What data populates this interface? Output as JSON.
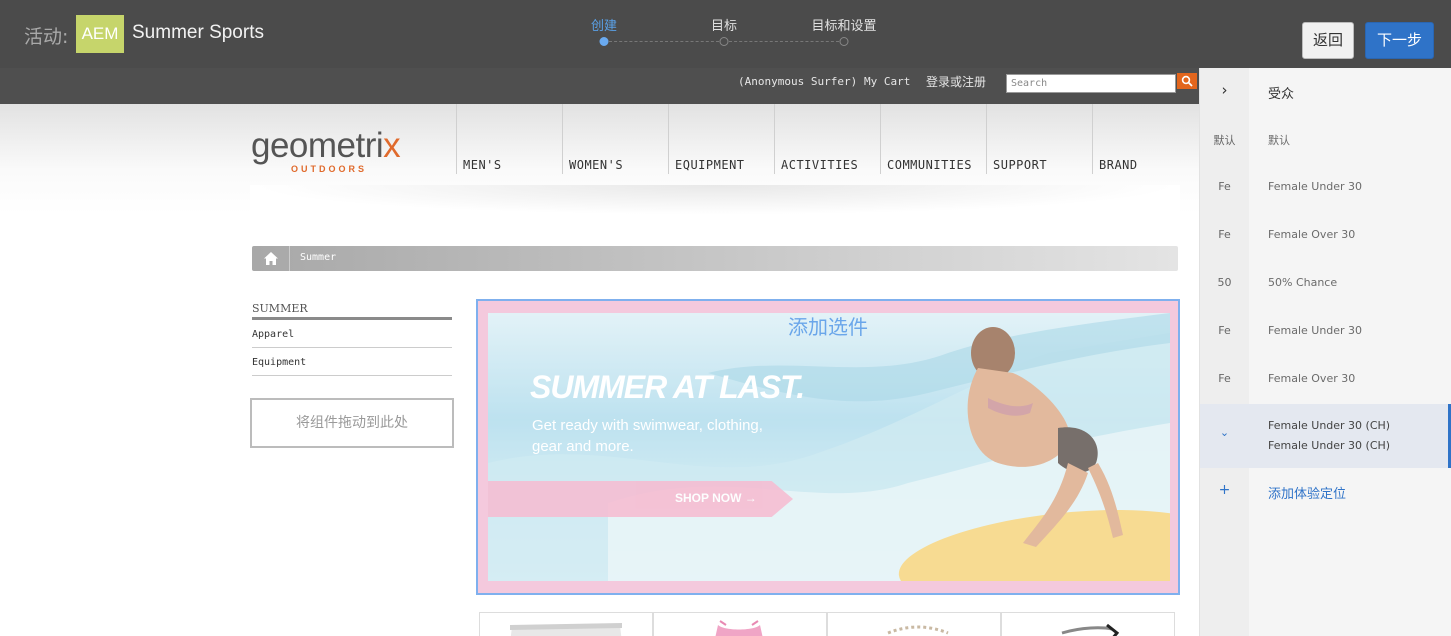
{
  "header": {
    "activity_label": "活动:",
    "badge": "AEM",
    "site_name": "Summer Sports",
    "steps": [
      {
        "label": "创建",
        "active": true
      },
      {
        "label": "目标",
        "active": false
      },
      {
        "label": "目标和设置",
        "active": false
      }
    ],
    "back_label": "返回",
    "next_label": "下一步"
  },
  "page": {
    "util_links": {
      "anonymous": "(Anonymous Surfer)",
      "cart": "My Cart",
      "login": "登录或注册"
    },
    "search_placeholder": "Search",
    "logo": {
      "main": "geometri",
      "x": "x",
      "sub": "OUTDOORS"
    },
    "nav": [
      "MEN'S",
      "WOMEN'S",
      "EQUIPMENT",
      "ACTIVITIES",
      "COMMUNITIES",
      "SUPPORT",
      "BRAND"
    ],
    "breadcrumb": "Summer",
    "sidebar": {
      "title": "SUMMER",
      "links": [
        "Apparel",
        "Equipment"
      ],
      "drop_zone": "将组件拖动到此处"
    },
    "offer": {
      "add_label": "添加选件",
      "headline": "SUMMER AT LAST.",
      "sub": "Get ready with swimwear, clothing, gear and more.",
      "cta": "SHOP NOW →"
    }
  },
  "panel": {
    "header": {
      "icon": "chevron-right-icon",
      "label": "受众"
    },
    "rows": [
      {
        "abbr": "默认",
        "label": "默认"
      },
      {
        "abbr": "Fe",
        "label": "Female Under 30"
      },
      {
        "abbr": "Fe",
        "label": "Female Over 30"
      },
      {
        "abbr": "50",
        "label": "50% Chance"
      },
      {
        "abbr": "Fe",
        "label": "Female Under 30"
      },
      {
        "abbr": "Fe",
        "label": "Female Over 30"
      }
    ],
    "selected": {
      "icon": "chevron-down-icon",
      "label": "Female Under 30 (CH)",
      "label2": "Female Under 30 (CH)"
    },
    "add": {
      "icon": "plus-icon",
      "label": "添加体验定位"
    }
  },
  "colors": {
    "topbar": "#4b4b4b",
    "accent": "#2f73c8",
    "aem_badge": "#c6d56b",
    "brand_orange": "#e06a2c"
  }
}
